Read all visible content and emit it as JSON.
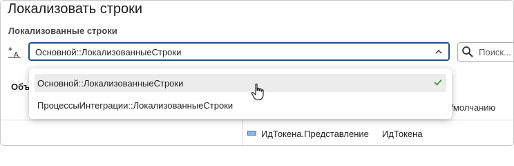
{
  "dialog": {
    "title": "Локализовать строки",
    "section_label": "Локализованные строки"
  },
  "combo": {
    "value": "Основной::ЛокализованныеСтроки",
    "icon": "language-icon"
  },
  "search": {
    "placeholder": "Поиск..."
  },
  "dropdown": {
    "options": [
      {
        "label": "Основной::ЛокализованныеСтроки",
        "selected": true
      },
      {
        "label": "ПроцессыИнтеграции::ЛокализованныеСтроки",
        "selected": false
      }
    ]
  },
  "background": {
    "partial_label": "Объ",
    "column_default": "оУмолчанию",
    "row": {
      "field_name": "ИдТокена.Представление",
      "field_value": "ИдТокена"
    }
  },
  "colors": {
    "accent_border": "#1e4f86",
    "check": "#2aa53a",
    "selected_row": "#ececec"
  }
}
